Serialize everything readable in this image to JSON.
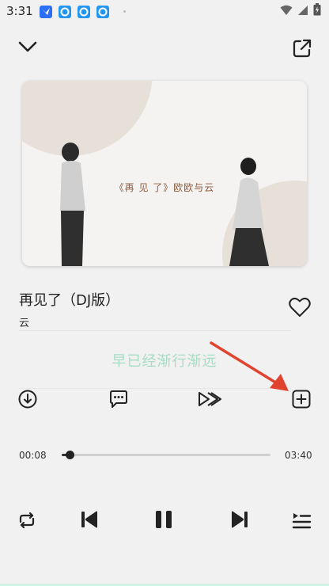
{
  "status_bar": {
    "time": "3:31",
    "app_icons": [
      "feishu-icon",
      "qq-icon",
      "qq-icon",
      "qq-icon"
    ],
    "right_icons": [
      "wifi-icon",
      "signal-icon",
      "battery-icon"
    ]
  },
  "header": {
    "left_icon": "chevron-down-icon",
    "right_icon": "share-icon"
  },
  "cover": {
    "caption": "《再 见 了》欧欧与云"
  },
  "song": {
    "title": "再见了（DJ版）",
    "artist": "云",
    "liked": false
  },
  "lyric": {
    "current_line": "早已经渐行渐远"
  },
  "actions": [
    "download-icon",
    "comment-icon",
    "speed-icon",
    "add-to-playlist-icon"
  ],
  "progress": {
    "elapsed": "00:08",
    "total": "03:40",
    "fraction": 0.036
  },
  "controls": [
    "repeat-icon",
    "previous-icon",
    "pause-icon",
    "next-icon",
    "playlist-icon"
  ],
  "colors": {
    "lyric": "#a7dcc4",
    "annotation_arrow": "#e0442f",
    "background": "#f1f1f1"
  }
}
